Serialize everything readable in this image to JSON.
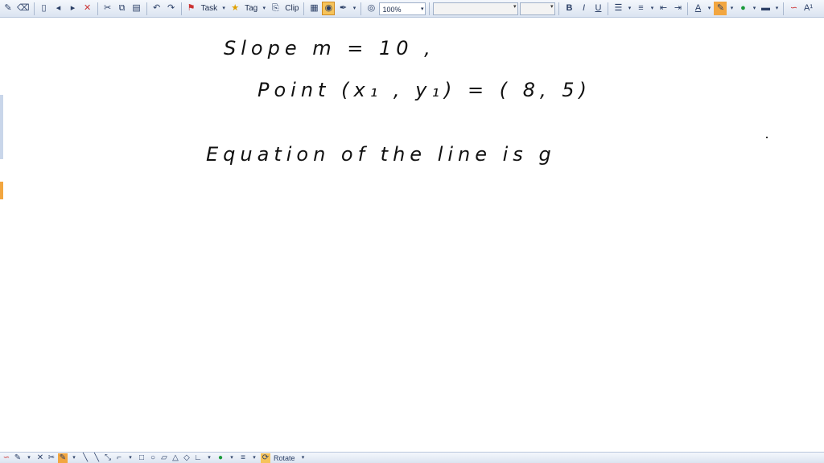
{
  "toolbar": {
    "task_label": "Task",
    "tag_label": "Tag",
    "clip_label": "Clip",
    "zoom_value": "100%",
    "bold_label": "B",
    "italic_label": "I",
    "underline_label": "U",
    "text_size_label": "A¹"
  },
  "bottom_bar": {
    "rotate_label": "Rotate"
  },
  "handwriting": {
    "line1": "Slope   m = 10 ,",
    "line2": "Point  (x₁ , y₁)  =  ( 8, 5)",
    "line3": "Equation  of  the  line  is  g"
  },
  "icons": [
    "new-page-icon",
    "back-icon",
    "forward-icon",
    "delete-page-icon",
    "cut-icon",
    "copy-icon",
    "paste-icon",
    "undo-icon",
    "redo-icon",
    "task-flag-icon",
    "tag-star-icon",
    "clip-icon",
    "table-icon",
    "audio-icon",
    "pen-icon",
    "web-icon",
    "bullets-icon",
    "numbering-icon",
    "decrease-indent-icon",
    "increase-indent-icon",
    "font-color-icon",
    "highlight-icon",
    "fill-color-icon",
    "line-style-icon",
    "eraser-icon",
    "lasso-icon",
    "scissors-icon",
    "line-tool-icon",
    "rect-tool-icon",
    "ellipse-tool-icon",
    "triangle-tool-icon",
    "diamond-tool-icon",
    "color-picker-icon"
  ],
  "colors": {
    "toolbar_top": "#f4f7fc",
    "toolbar_bottom": "#dbe4f1",
    "highlight": "#f2a640",
    "ink": "#111111"
  }
}
